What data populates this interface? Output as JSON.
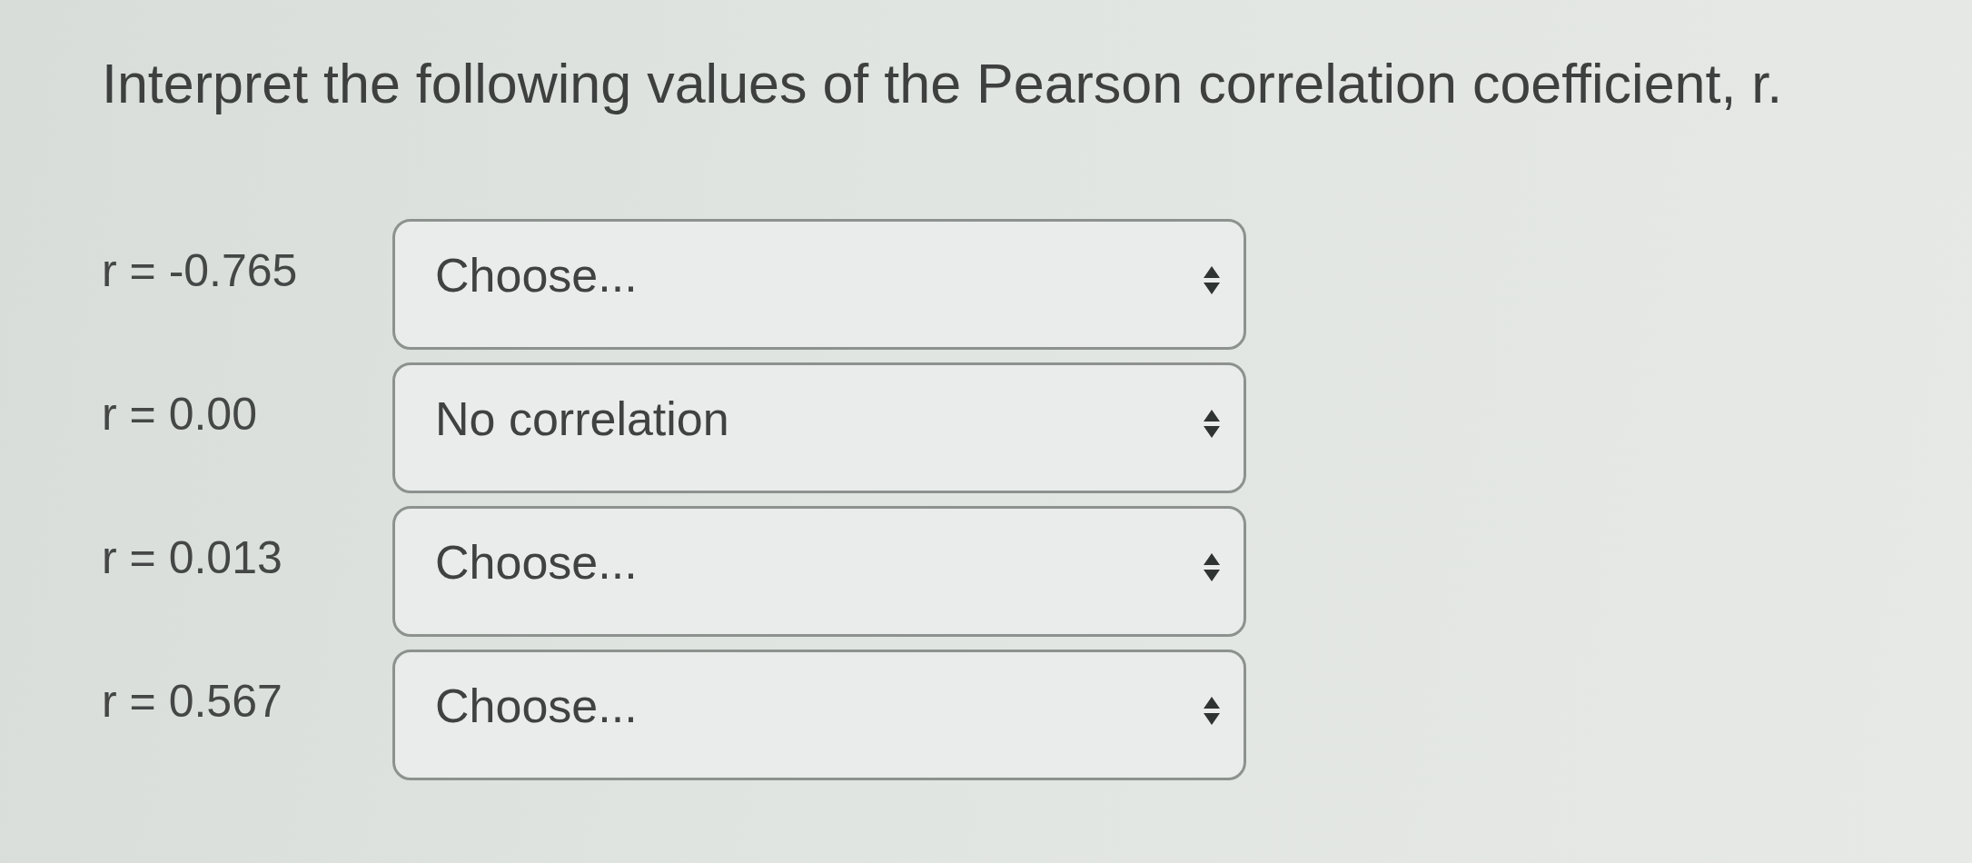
{
  "question": {
    "prompt": "Interpret the following values of the Pearson correlation coefficient, r."
  },
  "rows": [
    {
      "label": "r = -0.765",
      "value": "Choose..."
    },
    {
      "label": "r = 0.00",
      "value": "No correlation"
    },
    {
      "label": "r = 0.013",
      "value": "Choose..."
    },
    {
      "label": "r = 0.567",
      "value": "Choose..."
    }
  ]
}
